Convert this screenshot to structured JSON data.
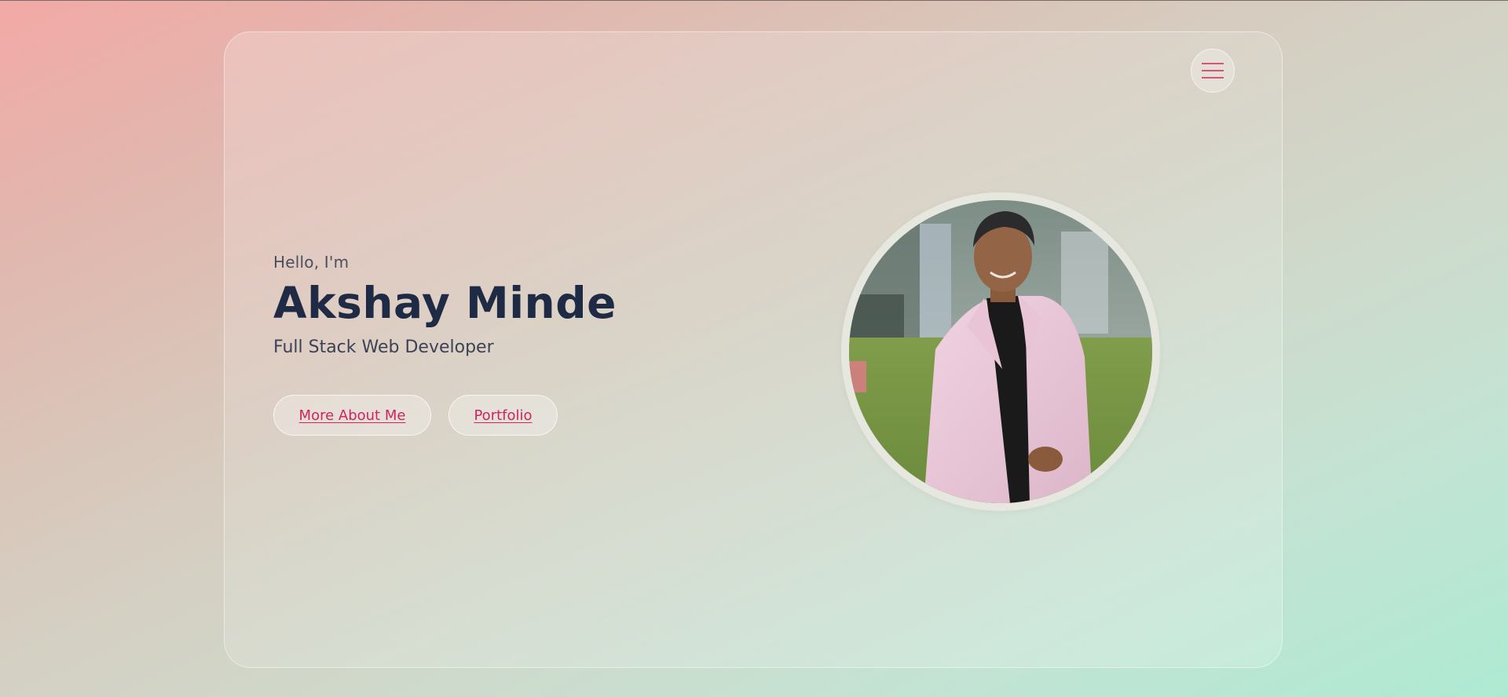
{
  "header": {
    "menu_icon": "hamburger-menu-icon"
  },
  "hero": {
    "greeting": "Hello, I'm",
    "name": "Akshay Minde",
    "role": "Full Stack Web Developer",
    "buttons": {
      "about": "More About Me",
      "portfolio": "Portfolio"
    },
    "photo_alt": "Akshay Minde"
  },
  "colors": {
    "accent": "#d0245f",
    "heading": "#1f2a44",
    "text": "#3c4256"
  }
}
